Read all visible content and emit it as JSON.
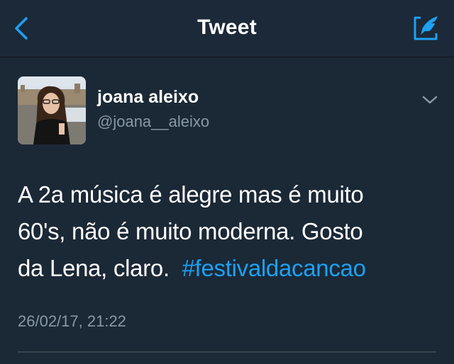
{
  "nav": {
    "title": "Tweet",
    "back_icon": "chevron-left-icon",
    "compose_icon": "compose-tweet-icon",
    "accent": "#1da1f2"
  },
  "tweet": {
    "author_name": "joana aleixo",
    "author_handle": "@joana__aleixo",
    "text_line1": "A 2a música é alegre mas é muito",
    "text_line2": "60's, não é muito moderna. Gosto",
    "text_line3_plain": "da Lena, claro.",
    "hashtag": "#festivaldacancao",
    "timestamp": "26/02/17, 21:22",
    "more_icon": "chevron-down-icon"
  },
  "colors": {
    "background": "#1b2836",
    "text": "#ffffff",
    "secondary_text": "#8899a6",
    "link": "#1da1f2"
  }
}
